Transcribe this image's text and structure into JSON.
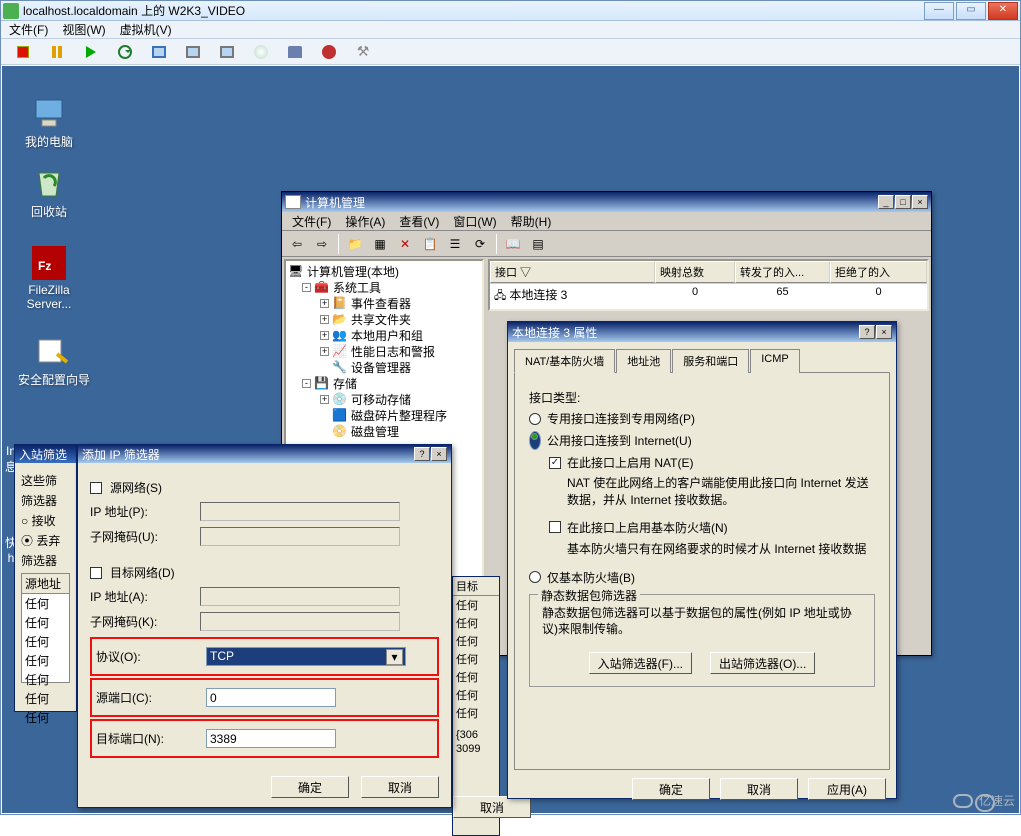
{
  "app": {
    "title": "localhost.localdomain 上的 W2K3_VIDEO",
    "menu": [
      "文件(F)",
      "视图(W)",
      "虚拟机(V)"
    ]
  },
  "desktop_icons": [
    {
      "label": "我的电脑",
      "icon": "computer"
    },
    {
      "label": "回收站",
      "icon": "recycle"
    },
    {
      "label": "FileZilla Server...",
      "icon": "filezilla"
    },
    {
      "label": "安全配置向导",
      "icon": "secwiz"
    },
    {
      "label": "In息",
      "icon": "info"
    },
    {
      "label": "快h",
      "icon": "shortcut"
    }
  ],
  "mmc": {
    "title": "计算机管理",
    "menu": [
      "文件(F)",
      "操作(A)",
      "查看(V)",
      "窗口(W)",
      "帮助(H)"
    ],
    "tree": [
      {
        "l": 0,
        "ex": "-",
        "label": "计算机管理(本地)"
      },
      {
        "l": 1,
        "ex": "-",
        "label": "系统工具"
      },
      {
        "l": 2,
        "ex": "+",
        "label": "事件查看器"
      },
      {
        "l": 2,
        "ex": "+",
        "label": "共享文件夹"
      },
      {
        "l": 2,
        "ex": "+",
        "label": "本地用户和组"
      },
      {
        "l": 2,
        "ex": "+",
        "label": "性能日志和警报"
      },
      {
        "l": 2,
        "ex": "",
        "label": "设备管理器"
      },
      {
        "l": 1,
        "ex": "-",
        "label": "存储"
      },
      {
        "l": 2,
        "ex": "+",
        "label": "可移动存储"
      },
      {
        "l": 2,
        "ex": "",
        "label": "磁盘碎片整理程序"
      },
      {
        "l": 2,
        "ex": "",
        "label": "磁盘管理"
      }
    ],
    "list": {
      "headers": [
        "接口 ▽",
        "映射总数",
        "转发了的入...",
        "拒绝了的入"
      ],
      "row": [
        "本地连接 3",
        "0",
        "65",
        "0"
      ]
    }
  },
  "prop": {
    "title": "本地连接 3 属性",
    "tabs": [
      "NAT/基本防火墙",
      "地址池",
      "服务和端口",
      "ICMP"
    ],
    "iface_type_label": "接口类型:",
    "r1": "专用接口连接到专用网络(P)",
    "r2": "公用接口连接到 Internet(U)",
    "c1": "在此接口上启用 NAT(E)",
    "c1_help": "NAT 使在此网络上的客户端能使用此接口向 Internet 发送数据，并从 Internet 接收数据。",
    "c2": "在此接口上启用基本防火墙(N)",
    "c2_help": "基本防火墙只有在网络要求的时候才从 Internet 接收数据",
    "r3": "仅基本防火墙(B)",
    "group": "静态数据包筛选器",
    "group_help": "静态数据包筛选器可以基于数据包的属性(例如 IP 地址或协议)来限制传输。",
    "bin": "入站筛选器(F)...",
    "bout": "出站筛选器(O)...",
    "ok": "确定",
    "cancel": "取消",
    "apply": "应用(A)"
  },
  "inb": {
    "title": "入站筛选",
    "line1": "这些筛",
    "opts": [
      "筛选器",
      "○ 接收",
      "⦿ 丢弃"
    ],
    "filters_label": "筛选器",
    "th": "源地址",
    "rows": [
      "任何",
      "任何",
      "任何",
      "任何",
      "任何",
      "任何",
      "任何"
    ]
  },
  "addip": {
    "title": "添加 IP 筛选器",
    "c_src": "源网络(S)",
    "ip_p": "IP 地址(P):",
    "mask_u": "子网掩码(U):",
    "c_dst": "目标网络(D)",
    "ip_a": "IP 地址(A):",
    "mask_k": "子网掩码(K):",
    "proto": "协议(O):",
    "proto_v": "TCP",
    "src_port": "源端口(C):",
    "src_port_v": "0",
    "dst_port": "目标端口(N):",
    "dst_port_v": "3389",
    "ok": "确定",
    "cancel": "取消"
  },
  "ghost": {
    "rows": [
      "目标",
      "任何",
      "任何",
      "任何",
      "任何",
      "任何",
      "任何",
      "任何"
    ],
    "foot": [
      "{306",
      "3099"
    ],
    "btn": "取消"
  },
  "watermark": "亿速云"
}
